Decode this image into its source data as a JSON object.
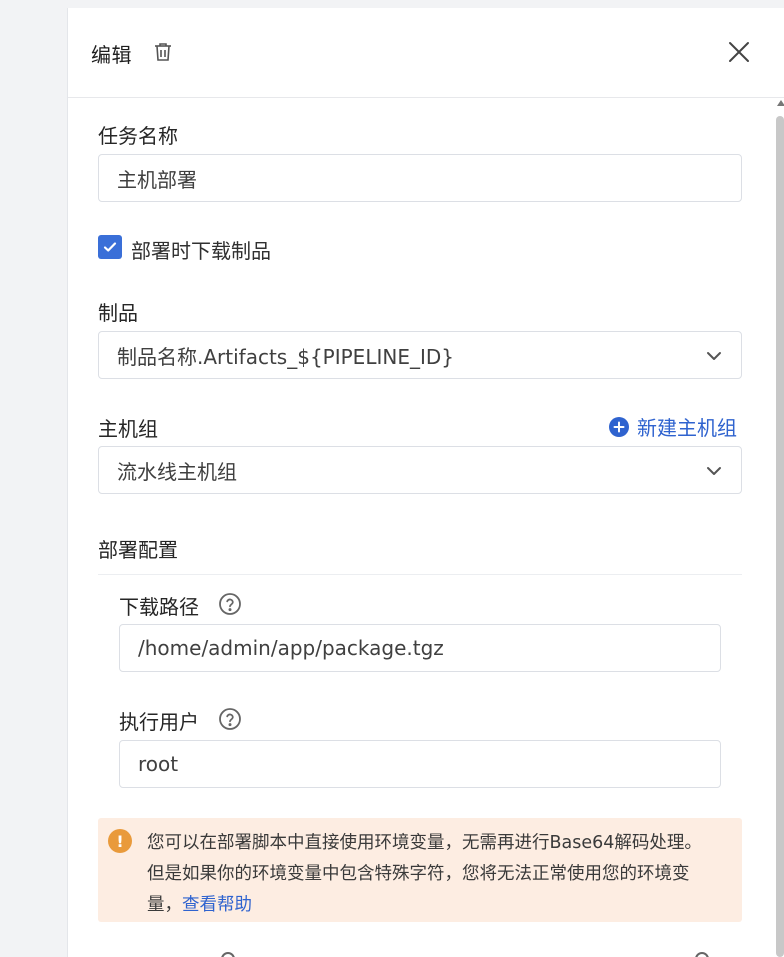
{
  "header": {
    "title": "编辑",
    "trash_icon": "trash-icon",
    "close_icon": "close-icon"
  },
  "task_name": {
    "label": "任务名称",
    "value": "主机部署"
  },
  "download_artifact": {
    "label": "部署时下载制品",
    "checked": true
  },
  "artifact": {
    "label": "制品",
    "selected": "制品名称.Artifacts_${PIPELINE_ID}"
  },
  "host_group": {
    "label": "主机组",
    "add_label": "新建主机组",
    "selected": "流水线主机组"
  },
  "deploy_config": {
    "label": "部署配置",
    "download_path": {
      "label": "下载路径",
      "value": "/home/admin/app/package.tgz"
    },
    "exec_user": {
      "label": "执行用户",
      "value": "root"
    }
  },
  "alert": {
    "icon": "!",
    "text": "您可以在部署脚本中直接使用环境变量，无需再进行Base64解码处理。但是如果你的环境变量中包含特殊字符，您将无法正常使用您的环境变量，",
    "link": "查看帮助"
  },
  "colors": {
    "primary": "#3a6fd8",
    "link": "#2f63cf",
    "alert_bg": "#fdede2",
    "alert_icon": "#e99a3b"
  }
}
